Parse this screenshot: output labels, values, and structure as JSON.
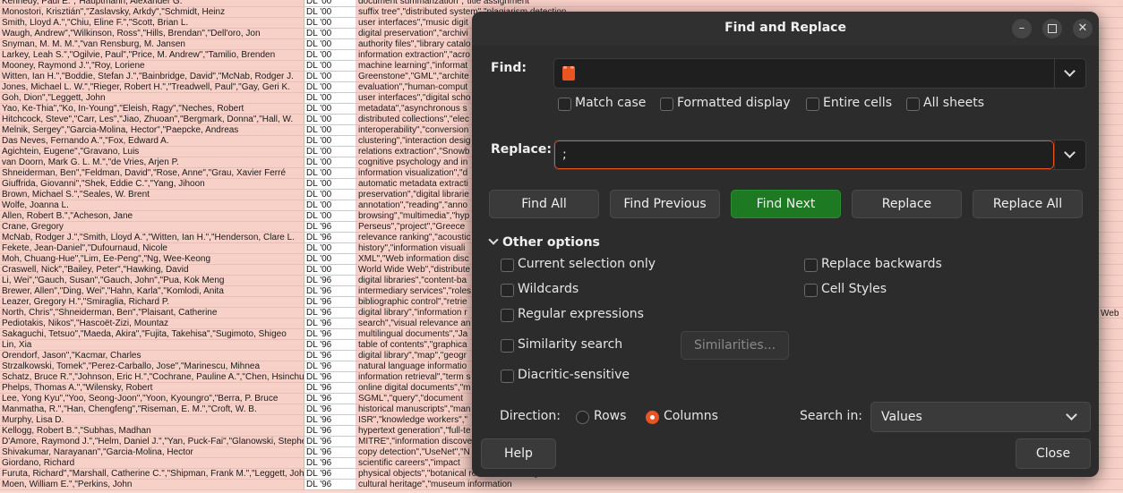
{
  "sheet": {
    "rows": [
      [
        "Kennedy, Paul E.\",\"Hauptmann, Alexander G.",
        "DL '00",
        "document summarization\",\"title assignment"
      ],
      [
        "Monostori, Krisztián\",\"Zaslavsky, Arkdy\",\"Schmidt, Heinz",
        "DL '00",
        "suffix tree\",\"distributed system\",\"plagiarism detection"
      ],
      [
        "Smith, Lloyd A.\",\"Chiu, Eline F.\",\"Scott, Brian L.",
        "DL '00",
        "user interfaces\",\"music digit"
      ],
      [
        "Waugh, Andrew\",\"Wilkinson, Ross\",\"Hills, Brendan\",\"Dell'oro, Jon",
        "DL '00",
        "digital preservation\",\"archivi"
      ],
      [
        "Snyman, M. M. M.\",\"van Rensburg, M. Jansen",
        "DL '00",
        "authority files\",\"library catalo"
      ],
      [
        "Larkey, Leah S.\",\"Ogilvie, Paul\",\"Price, M. Andrew\",\"Tamilio, Brenden",
        "DL '00",
        "information extraction\",\"acro"
      ],
      [
        "Mooney, Raymond J.\",\"Roy, Loriene",
        "DL '00",
        "machine learning\",\"informat"
      ],
      [
        "Witten, Ian H.\",\"Boddie, Stefan J.\",\"Bainbridge, David\",\"McNab, Rodger J.",
        "DL '00",
        "Greenstone\",\"GML\",\"archite"
      ],
      [
        "Jones, Michael L. W.\",\"Rieger, Robert H.\",\"Treadwell, Paul\",\"Gay, Geri K.",
        "DL '00",
        "evaluation\",\"human-comput"
      ],
      [
        "Goh, Dion\",\"Leggett, John",
        "DL '00",
        "user interfaces\",\"digital scho"
      ],
      [
        "Yao, Ke-Thia\",\"Ko, In-Young\",\"Eleish, Ragy\",\"Neches, Robert",
        "DL '00",
        "metadata\",\"asynchronous s"
      ],
      [
        "Hitchcock, Steve\",\"Carr, Les\",\"Jiao, Zhuoan\",\"Bergmark, Donna\",\"Hall, W.",
        "DL '00",
        "distributed collections\",\"elec"
      ],
      [
        "Melnik, Sergey\",\"Garcia-Molina, Hector\",\"Paepcke, Andreas",
        "DL '00",
        "interoperability\",\"conversion"
      ],
      [
        "Das Neves, Fernando A.\",\"Fox, Edward A.",
        "DL '00",
        "clustering\",\"interaction desig"
      ],
      [
        "Agichtein, Eugene\",\"Gravano, Luis",
        "DL '00",
        "relations extraction\",\"Snowb"
      ],
      [
        "van Doorn, Mark G. L. M.\",\"de Vries, Arjen P.",
        "DL '00",
        "cognitive psychology and in"
      ],
      [
        "Shneiderman, Ben\",\"Feldman, David\",\"Rose, Anne\",\"Grau, Xavier Ferré",
        "DL '00",
        "information visualization\",\"d"
      ],
      [
        "Giuffrida, Giovanni\",\"Shek, Eddie C.\",\"Yang, Jihoon",
        "DL '00",
        "automatic metadata extracti"
      ],
      [
        "Brown, Michael S.\",\"Seales, W. Brent",
        "DL '00",
        "preservation\",\"digital librarie"
      ],
      [
        "Wolfe, Joanna L.",
        "DL '00",
        "annotation\",\"reading\",\"anno"
      ],
      [
        "Allen, Robert B.\",\"Acheson, Jane",
        "DL '00",
        "browsing\",\"multimedia\",\"hyp"
      ],
      [
        "Crane, Gregory",
        "DL '96",
        "Perseus\",\"project\",\"Greece"
      ],
      [
        "McNab, Rodger J.\",\"Smith, Lloyd A.\",\"Witten, Ian H.\",\"Henderson, Clare L.",
        "DL '96",
        "relevance ranking\",\"acoustic"
      ],
      [
        "Fekete, Jean-Daniel\",\"Dufournaud, Nicole",
        "DL '00",
        "history\",\"information visuali"
      ],
      [
        "Moh, Chuang-Hue\",\"Lim, Ee-Peng\",\"Ng, Wee-Keong",
        "DL '00",
        "XML\",\"Web information disc"
      ],
      [
        "Craswell, Nick\",\"Bailey, Peter\",\"Hawking, David",
        "DL '00",
        "World Wide Web\",\"distribute"
      ],
      [
        "Li, Wei\",\"Gauch, Susan\",\"Gauch, John\",\"Pua, Kok Meng",
        "DL '96",
        "digital libraries\",\"content-ba"
      ],
      [
        "Brewer, Allen\",\"Ding, Wei\",\"Hahn, Karla\",\"Komlodi, Anita",
        "DL '96",
        "intermediary services\",\"roles"
      ],
      [
        "Leazer, Gregory H.\",\"Smiraglia, Richard P.",
        "DL '96",
        "bibliographic control\",\"retrie"
      ],
      [
        "North, Chris\",\"Shneiderman, Ben\",\"Plaisant, Catherine",
        "DL '96",
        "digital library\",\"information r"
      ],
      [
        "Pediotakis, Nikos\",\"Hascoët-Zizi, Mountaz",
        "DL '96",
        "search\",\"visual relevance an"
      ],
      [
        "Sakaguchi, Tetsuo\",\"Maeda, Akira\",\"Fujita, Takehisa\",\"Sugimoto, Shigeo",
        "DL '96",
        "multilingual documents\",\"Ja"
      ],
      [
        "Lin, Xia",
        "DL '96",
        "table of contents\",\"graphica"
      ],
      [
        "Orendorf, Jason\",\"Kacmar, Charles",
        "DL '96",
        "digital library\",\"map\",\"geogr"
      ],
      [
        "Strzalkowski, Tomek\",\"Perez-Carballo, Jose\",\"Marinescu, Mihnea",
        "DL '96",
        "natural language informatio"
      ],
      [
        "Schatz, Bruce R.\",\"Johnson, Eric H.\",\"Cochrane, Pauline A.\",\"Chen, Hsinchun",
        "DL '96",
        "information retrieval\",\"term s"
      ],
      [
        "Phelps, Thomas A.\",\"Wilensky, Robert",
        "DL '96",
        "online digital documents\",\"m"
      ],
      [
        "Lee, Yong Kyu\",\"Yoo, Seong-Joon\",\"Yoon, Kyoungro\",\"Berra, P. Bruce",
        "DL '96",
        "SGML\",\"query\",\"document"
      ],
      [
        "Manmatha, R.\",\"Han, Chengfeng\",\"Riseman, E. M.\",\"Croft, W. B.",
        "DL '96",
        "historical manuscripts\",\"man"
      ],
      [
        "Murphy, Lisa D.",
        "DL '96",
        "ISR\",\"knowledge workers\",\""
      ],
      [
        "Kellogg, Robert B.\",\"Subhas, Madhan",
        "DL '96",
        "hypertext generation\",\"full-te"
      ],
      [
        "D'Amore, Raymond J.\",\"Helm, Daniel J.\",\"Yan, Puck-Fai\",\"Glanowski, Stephen",
        "DL '96",
        "MITRE\",\"information discove"
      ],
      [
        "Shivakumar, Narayanan\",\"Garcia-Molina, Hector",
        "DL '96",
        "copy detection\",\"UseNet\",\"N"
      ],
      [
        "Giordano, Richard",
        "DL '96",
        "scientific careers\",\"impact"
      ],
      [
        "Furuta, Richard\",\"Marshall, Catherine C.\",\"Shipman, Frank M.\",\"Leggett, John",
        "DL '96",
        "physical objects\",\"botanical research\",\"botany"
      ],
      [
        "Moen, William E.\",\"Perkins, John",
        "DL '96",
        "cultural heritage\",\"museum information"
      ]
    ],
    "right_edge_text": "Web"
  },
  "dialog": {
    "title": "Find and Replace",
    "find_label": "Find:",
    "find_value": "\" \"",
    "replace_label": "Replace:",
    "replace_value": ";",
    "checks": {
      "match_case": "Match case",
      "formatted_display": "Formatted display",
      "entire_cells": "Entire cells",
      "all_sheets": "All sheets"
    },
    "buttons": {
      "find_all": "Find All",
      "find_previous": "Find Previous",
      "find_next": "Find Next",
      "replace": "Replace",
      "replace_all": "Replace All",
      "help": "Help",
      "close": "Close",
      "similarities": "Similarities..."
    },
    "other_options": "Other options",
    "options": {
      "current_selection_only": "Current selection only",
      "replace_backwards": "Replace backwards",
      "wildcards": "Wildcards",
      "cell_styles": "Cell Styles",
      "regular_expressions": "Regular expressions",
      "similarity_search": "Similarity search",
      "diacritic_sensitive": "Diacritic-sensitive"
    },
    "direction_label": "Direction:",
    "direction_rows": "Rows",
    "direction_columns": "Columns",
    "direction_selected": "Columns",
    "search_in_label": "Search in:",
    "search_in_value": "Values",
    "accent_color": "#1e7a22",
    "focus_color": "#e95420"
  }
}
